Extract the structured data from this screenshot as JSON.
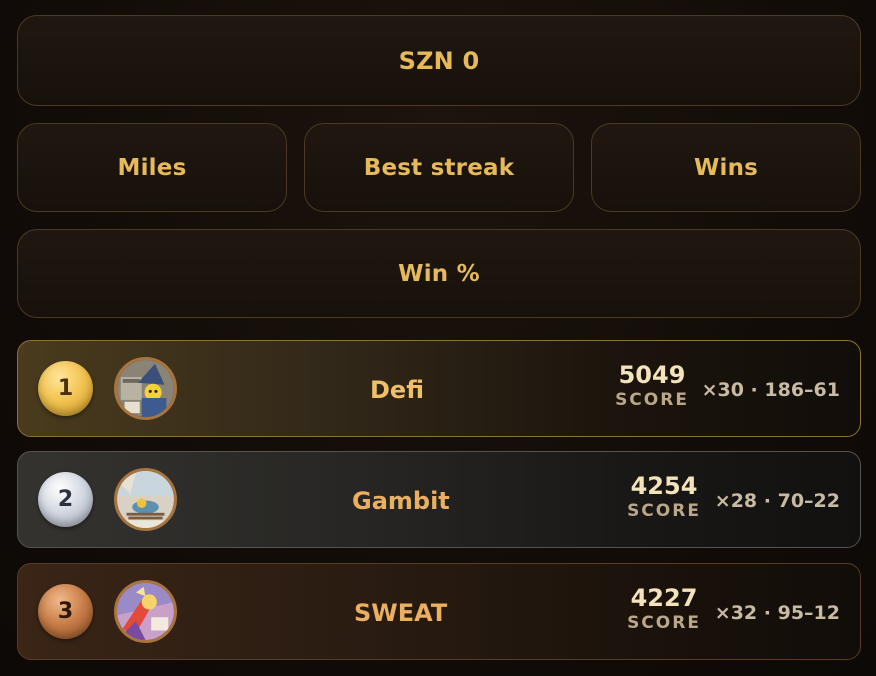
{
  "season": {
    "label": "SZN 0"
  },
  "stats": {
    "miles": "Miles",
    "best_streak": "Best streak",
    "wins": "Wins",
    "win_pct": "Win %"
  },
  "leaderboard": [
    {
      "rank": "1",
      "name": "Defi",
      "score": "5049",
      "score_label": "SCORE",
      "record": "×30 · 186–61",
      "medal": "gold"
    },
    {
      "rank": "2",
      "name": "Gambit",
      "score": "4254",
      "score_label": "SCORE",
      "record": "×28 · 70–22",
      "medal": "silver"
    },
    {
      "rank": "3",
      "name": "SWEAT",
      "score": "4227",
      "score_label": "SCORE",
      "record": "×32 · 95–12",
      "medal": "bronze"
    }
  ],
  "colors": {
    "accent_gold": "#e6b95a",
    "background": "#120c08",
    "medal_gold": "#f2c453",
    "medal_silver": "#d4d9e2",
    "medal_bronze": "#c57a45"
  }
}
